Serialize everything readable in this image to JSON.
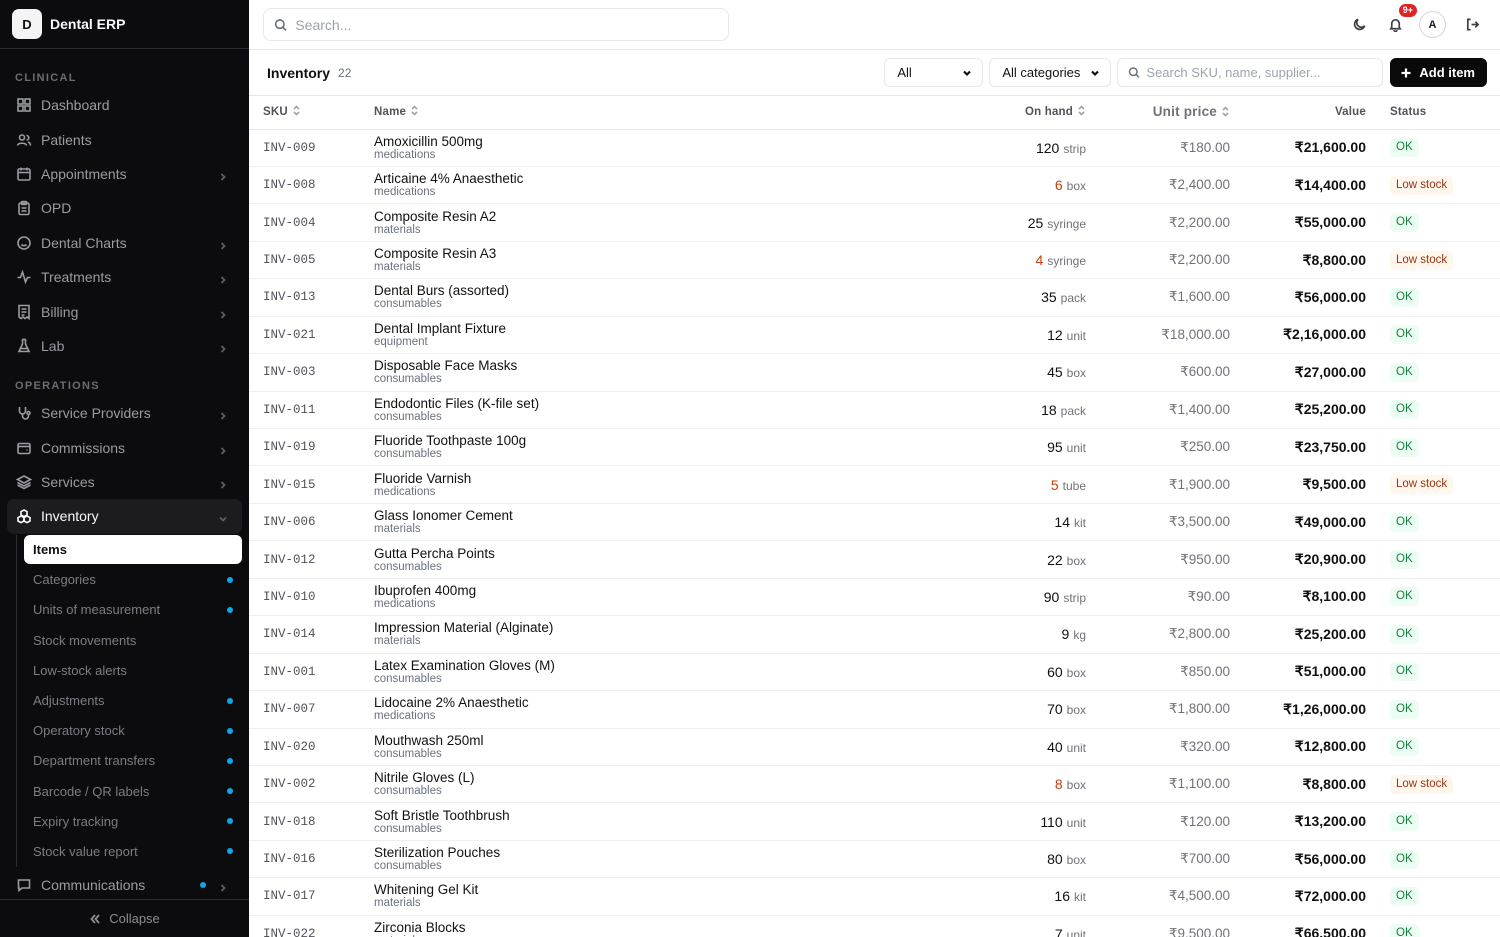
{
  "app": {
    "logo_letter": "D",
    "name": "Dental ERP"
  },
  "sidebar": {
    "section_clinical": "CLINICAL",
    "clinical": [
      {
        "label": "Dashboard",
        "icon": "dashboard-icon",
        "chevron": false
      },
      {
        "label": "Patients",
        "icon": "users-icon",
        "chevron": false
      },
      {
        "label": "Appointments",
        "icon": "calendar-icon",
        "chevron": true
      },
      {
        "label": "OPD",
        "icon": "clipboard-icon",
        "chevron": false
      },
      {
        "label": "Dental Charts",
        "icon": "smile-icon",
        "chevron": true
      },
      {
        "label": "Treatments",
        "icon": "activity-icon",
        "chevron": true
      },
      {
        "label": "Billing",
        "icon": "receipt-icon",
        "chevron": true
      },
      {
        "label": "Lab",
        "icon": "flask-icon",
        "chevron": true
      }
    ],
    "section_operations": "OPERATIONS",
    "operations": [
      {
        "label": "Service Providers",
        "icon": "stethoscope-icon",
        "chevron": true
      },
      {
        "label": "Commissions",
        "icon": "wallet-icon",
        "chevron": true
      },
      {
        "label": "Services",
        "icon": "layers-icon",
        "chevron": true
      }
    ],
    "inventory_label": "Inventory",
    "inventory_sub": [
      {
        "label": "Items",
        "active": true,
        "dot": false
      },
      {
        "label": "Categories",
        "active": false,
        "dot": true
      },
      {
        "label": "Units of measurement",
        "active": false,
        "dot": true
      },
      {
        "label": "Stock movements",
        "active": false,
        "dot": false
      },
      {
        "label": "Low-stock alerts",
        "active": false,
        "dot": false
      },
      {
        "label": "Adjustments",
        "active": false,
        "dot": true
      },
      {
        "label": "Operatory stock",
        "active": false,
        "dot": true
      },
      {
        "label": "Department transfers",
        "active": false,
        "dot": true
      },
      {
        "label": "Barcode / QR labels",
        "active": false,
        "dot": true
      },
      {
        "label": "Expiry tracking",
        "active": false,
        "dot": true
      },
      {
        "label": "Stock value report",
        "active": false,
        "dot": true
      }
    ],
    "communications_label": "Communications",
    "collapse_label": "Collapse"
  },
  "topbar": {
    "search_placeholder": "Search...",
    "notifications_badge": "9+",
    "avatar_letter": "A"
  },
  "toolbar": {
    "title": "Inventory",
    "count": "22",
    "status_filter": "All",
    "category_filter": "All categories",
    "search_placeholder": "Search SKU, name, supplier...",
    "add_label": "Add item"
  },
  "table": {
    "headers": {
      "sku": "SKU",
      "name": "Name",
      "on_hand": "On hand",
      "unit_price": "Unit price",
      "value": "Value",
      "status": "Status"
    },
    "rows": [
      {
        "sku": "INV-009",
        "name": "Amoxicillin 500mg",
        "category": "medications",
        "qty": "120",
        "unit": "strip",
        "price": "₹180.00",
        "value": "₹21,600.00",
        "status": "OK",
        "low": false
      },
      {
        "sku": "INV-008",
        "name": "Articaine 4% Anaesthetic",
        "category": "medications",
        "qty": "6",
        "unit": "box",
        "price": "₹2,400.00",
        "value": "₹14,400.00",
        "status": "Low stock",
        "low": true
      },
      {
        "sku": "INV-004",
        "name": "Composite Resin A2",
        "category": "materials",
        "qty": "25",
        "unit": "syringe",
        "price": "₹2,200.00",
        "value": "₹55,000.00",
        "status": "OK",
        "low": false
      },
      {
        "sku": "INV-005",
        "name": "Composite Resin A3",
        "category": "materials",
        "qty": "4",
        "unit": "syringe",
        "price": "₹2,200.00",
        "value": "₹8,800.00",
        "status": "Low stock",
        "low": true
      },
      {
        "sku": "INV-013",
        "name": "Dental Burs (assorted)",
        "category": "consumables",
        "qty": "35",
        "unit": "pack",
        "price": "₹1,600.00",
        "value": "₹56,000.00",
        "status": "OK",
        "low": false
      },
      {
        "sku": "INV-021",
        "name": "Dental Implant Fixture",
        "category": "equipment",
        "qty": "12",
        "unit": "unit",
        "price": "₹18,000.00",
        "value": "₹2,16,000.00",
        "status": "OK",
        "low": false
      },
      {
        "sku": "INV-003",
        "name": "Disposable Face Masks",
        "category": "consumables",
        "qty": "45",
        "unit": "box",
        "price": "₹600.00",
        "value": "₹27,000.00",
        "status": "OK",
        "low": false
      },
      {
        "sku": "INV-011",
        "name": "Endodontic Files (K-file set)",
        "category": "consumables",
        "qty": "18",
        "unit": "pack",
        "price": "₹1,400.00",
        "value": "₹25,200.00",
        "status": "OK",
        "low": false
      },
      {
        "sku": "INV-019",
        "name": "Fluoride Toothpaste 100g",
        "category": "consumables",
        "qty": "95",
        "unit": "unit",
        "price": "₹250.00",
        "value": "₹23,750.00",
        "status": "OK",
        "low": false
      },
      {
        "sku": "INV-015",
        "name": "Fluoride Varnish",
        "category": "medications",
        "qty": "5",
        "unit": "tube",
        "price": "₹1,900.00",
        "value": "₹9,500.00",
        "status": "Low stock",
        "low": true
      },
      {
        "sku": "INV-006",
        "name": "Glass Ionomer Cement",
        "category": "materials",
        "qty": "14",
        "unit": "kit",
        "price": "₹3,500.00",
        "value": "₹49,000.00",
        "status": "OK",
        "low": false
      },
      {
        "sku": "INV-012",
        "name": "Gutta Percha Points",
        "category": "consumables",
        "qty": "22",
        "unit": "box",
        "price": "₹950.00",
        "value": "₹20,900.00",
        "status": "OK",
        "low": false
      },
      {
        "sku": "INV-010",
        "name": "Ibuprofen 400mg",
        "category": "medications",
        "qty": "90",
        "unit": "strip",
        "price": "₹90.00",
        "value": "₹8,100.00",
        "status": "OK",
        "low": false
      },
      {
        "sku": "INV-014",
        "name": "Impression Material (Alginate)",
        "category": "materials",
        "qty": "9",
        "unit": "kg",
        "price": "₹2,800.00",
        "value": "₹25,200.00",
        "status": "OK",
        "low": false
      },
      {
        "sku": "INV-001",
        "name": "Latex Examination Gloves (M)",
        "category": "consumables",
        "qty": "60",
        "unit": "box",
        "price": "₹850.00",
        "value": "₹51,000.00",
        "status": "OK",
        "low": false
      },
      {
        "sku": "INV-007",
        "name": "Lidocaine 2% Anaesthetic",
        "category": "medications",
        "qty": "70",
        "unit": "box",
        "price": "₹1,800.00",
        "value": "₹1,26,000.00",
        "status": "OK",
        "low": false
      },
      {
        "sku": "INV-020",
        "name": "Mouthwash 250ml",
        "category": "consumables",
        "qty": "40",
        "unit": "unit",
        "price": "₹320.00",
        "value": "₹12,800.00",
        "status": "OK",
        "low": false
      },
      {
        "sku": "INV-002",
        "name": "Nitrile Gloves (L)",
        "category": "consumables",
        "qty": "8",
        "unit": "box",
        "price": "₹1,100.00",
        "value": "₹8,800.00",
        "status": "Low stock",
        "low": true
      },
      {
        "sku": "INV-018",
        "name": "Soft Bristle Toothbrush",
        "category": "consumables",
        "qty": "110",
        "unit": "unit",
        "price": "₹120.00",
        "value": "₹13,200.00",
        "status": "OK",
        "low": false
      },
      {
        "sku": "INV-016",
        "name": "Sterilization Pouches",
        "category": "consumables",
        "qty": "80",
        "unit": "box",
        "price": "₹700.00",
        "value": "₹56,000.00",
        "status": "OK",
        "low": false
      },
      {
        "sku": "INV-017",
        "name": "Whitening Gel Kit",
        "category": "materials",
        "qty": "16",
        "unit": "kit",
        "price": "₹4,500.00",
        "value": "₹72,000.00",
        "status": "OK",
        "low": false
      },
      {
        "sku": "INV-022",
        "name": "Zirconia Blocks",
        "category": "materials",
        "qty": "7",
        "unit": "unit",
        "price": "₹9,500.00",
        "value": "₹66,500.00",
        "status": "OK",
        "low": false
      }
    ]
  },
  "colors": {
    "accent_dot": "#0ea5e9",
    "low_qty": "#c2410c",
    "ok_text": "#15803d",
    "badge": "#dc2626"
  }
}
